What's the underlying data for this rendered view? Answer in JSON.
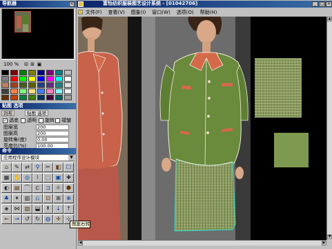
{
  "left_panel": {
    "navigator_title": "导航器",
    "zoom_value": "100 %",
    "palette_colors": [
      "#000000",
      "#800000",
      "#008000",
      "#808000",
      "#000080",
      "#800080",
      "#008080",
      "#c0c0c0",
      "#808080",
      "#ff0000",
      "#00ff00",
      "#ffff00",
      "#0000ff",
      "#ff00ff",
      "#00ffff",
      "#ffffff",
      "#c08060",
      "#a04020",
      "#406020",
      "#606000",
      "#204080",
      "#603080",
      "#208080",
      "#e0e0e0",
      "#404040",
      "#ff8040",
      "#80ff80",
      "#ffe080",
      "#4080ff",
      "#ff80c0",
      "#80ffff",
      "#f0f0f0",
      "#603000",
      "#c04000",
      "#008040",
      "#408000",
      "#003060",
      "#400040",
      "#006060",
      "#a0a0a0"
    ],
    "tiling": {
      "title": "贴图 选项",
      "tabs": [
        "刘布",
        "贴图 选项"
      ],
      "checkbox_transparent_bg": "透底",
      "checkbox_transparent": "透明",
      "checkbox_rotate": "旋转",
      "checkbox_wrinkle": "褶皱",
      "rows": [
        {
          "label": "图案宽",
          "value": "200"
        },
        {
          "label": "图案高",
          "value": "200"
        },
        {
          "label": "旋转角(度)",
          "value": "0.00"
        },
        {
          "label": "亮度比(%)",
          "value": "100.00"
        }
      ]
    },
    "command": {
      "title": "命令",
      "dropdown_value": "应用程序设计模块"
    },
    "tooltip": "图案右转"
  },
  "main_window": {
    "title": "富怡纺织服装图艺设计系统 - [01042706]",
    "menu": [
      "文件(F)",
      "查看(V)",
      "图象(I)",
      "窗口(W)",
      "选项(O)",
      "帮助(H)"
    ]
  },
  "colors": {
    "jacket_green": "#6a8a3c",
    "jacket_red": "#c8624a",
    "collar_red": "#d46a4a",
    "swatch_green": "#7e9a50",
    "title_blue": "#0a246a",
    "panel_gray": "#c0c0c0"
  }
}
